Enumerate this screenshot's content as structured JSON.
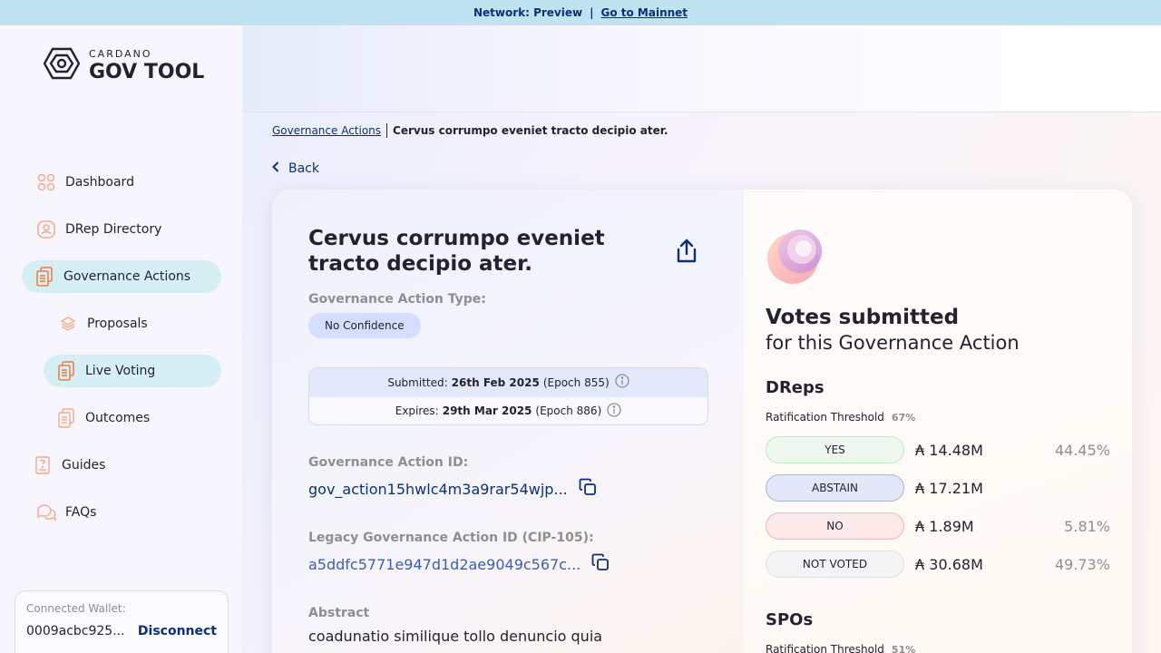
{
  "banner": {
    "network": "Network: Preview",
    "separator": "|",
    "link": "Go to Mainnet"
  },
  "logo": {
    "line1": "CARDANO",
    "line2": "GOV TOOL"
  },
  "sidebar": {
    "items": [
      {
        "label": "Dashboard",
        "icon": "dashboard-icon"
      },
      {
        "label": "DRep Directory",
        "icon": "drep-directory-icon"
      },
      {
        "label": "Governance Actions",
        "icon": "governance-actions-icon"
      },
      {
        "label": "Proposals",
        "icon": "proposals-icon"
      },
      {
        "label": "Live Voting",
        "icon": "live-voting-icon"
      },
      {
        "label": "Outcomes",
        "icon": "outcomes-icon"
      },
      {
        "label": "Guides",
        "icon": "guides-icon"
      },
      {
        "label": "FAQs",
        "icon": "faqs-icon"
      }
    ],
    "wallet": {
      "label": "Connected Wallet:",
      "address": "0009acbc925...",
      "disconnect": "Disconnect"
    }
  },
  "breadcrumb": {
    "root": "Governance Actions",
    "current": "Cervus corrumpo eveniet tracto decipio ater."
  },
  "back": "Back",
  "action": {
    "title": "Cervus corrumpo eveniet tracto decipio ater.",
    "type_label": "Governance Action Type:",
    "type_value": "No Confidence",
    "submitted_label": "Submitted:",
    "submitted_date": "26th Feb 2025",
    "submitted_epoch": "(Epoch 855)",
    "expires_label": "Expires:",
    "expires_date": "29th Mar 2025",
    "expires_epoch": "(Epoch 886)",
    "id_label": "Governance Action ID:",
    "id_value": "gov_action15hwlc4m3a9rar54wjp...",
    "legacy_label": "Legacy Governance Action ID (CIP-105):",
    "legacy_value": "a5ddfc5771e947d1d2ae9049c567c...",
    "abstract_label": "Abstract",
    "abstract_value": "coadunatio similique tollo denuncio quia"
  },
  "votes": {
    "title": "Votes submitted",
    "subtitle": "for this Governance Action",
    "dreps": {
      "heading": "DReps",
      "threshold_label": "Ratification Threshold",
      "threshold_value": "67%",
      "rows": [
        {
          "label": "YES",
          "amount": "₳ 14.48M",
          "percent": "44.45%"
        },
        {
          "label": "ABSTAIN",
          "amount": "₳ 17.21M",
          "percent": ""
        },
        {
          "label": "NO",
          "amount": "₳ 1.89M",
          "percent": "5.81%"
        },
        {
          "label": "NOT VOTED",
          "amount": "₳ 30.68M",
          "percent": "49.73%"
        }
      ]
    },
    "spos": {
      "heading": "SPOs",
      "threshold_label": "Ratification Threshold",
      "threshold_value": "51%"
    }
  },
  "colors": {
    "accent": "#0b2f7a",
    "banner": "#bfe3f1",
    "active_nav": "#d6eff5"
  }
}
